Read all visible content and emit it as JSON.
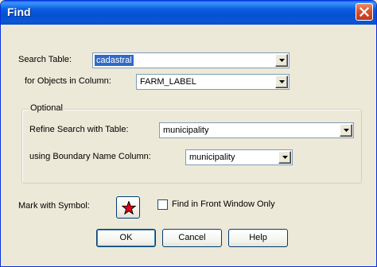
{
  "window": {
    "title": "Find"
  },
  "icons": {
    "close": "close-icon",
    "dropdown": "chevron-down-icon",
    "symbol": "red-star-icon"
  },
  "colors": {
    "selection": "#316ac5",
    "star": "#e3001b",
    "titlebar": "#0a5ee0",
    "close": "#d65331"
  },
  "search_table": {
    "label": "Search Table:",
    "value": "cadastral"
  },
  "objects_column": {
    "label": "for Objects in Column:",
    "value": "FARM_LABEL"
  },
  "optional": {
    "legend": "Optional",
    "refine": {
      "label": "Refine Search with Table:",
      "value": "municipality"
    },
    "boundary": {
      "label": "using Boundary Name Column:",
      "value": "municipality"
    }
  },
  "mark": {
    "label": "Mark with Symbol:"
  },
  "front_window": {
    "label": "Find in Front Window Only",
    "checked": false
  },
  "buttons": {
    "ok": "OK",
    "cancel": "Cancel",
    "help": "Help"
  }
}
